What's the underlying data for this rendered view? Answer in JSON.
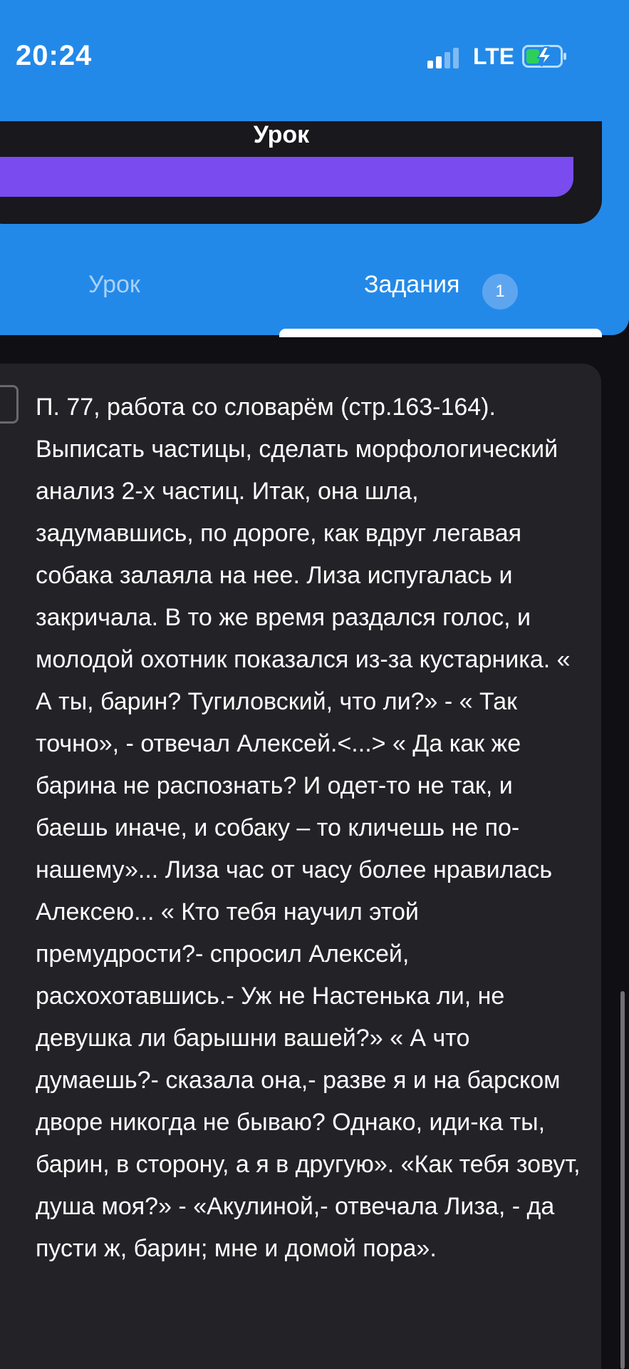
{
  "status_bar": {
    "time": "20:24",
    "network": "LTE",
    "signal_icon": "signal-bars-icon",
    "battery_icon": "battery-charging-icon",
    "battery_color": "#2dcf5b"
  },
  "header": {
    "title": "Урок",
    "background_color": "#2389e8",
    "progress_color": "#7a4cf0"
  },
  "tabs": [
    {
      "label": "Урок",
      "active": false
    },
    {
      "label": "Задания",
      "active": true,
      "badge": "1"
    }
  ],
  "task": {
    "checkbox_icon": "checkbox-icon",
    "text": "П. 77, работа со словарём (стр.163-164). Выписать частицы, сделать морфологический анализ 2-х частиц. Итак, она шла, задумавшись, по дороге, как вдруг легавая собака залаяла на нее. Лиза испугалась и закричала. В то же время раздался голос, и молодой охотник показался  из-за кустарника. « А ты, барин? Тугиловский,  что ли?» - « Так точно», - отвечал Алексей.<...> « Да как же барина не распознать? И одет-то не так, и баешь иначе, и собаку – то кличешь не по-нашему»... Лиза час от часу более нравилась Алексею... « Кто тебя научил этой премудрости?- спросил Алексей, расхохотавшись.- Уж не Настенька ли, не девушка ли барышни вашей?» « А что думаешь?- сказала она,- разве я и на барском дворе никогда не бываю? Однако, иди-ка ты, барин, в сторону, а я в другую». «Как тебя зовут, душа моя?» - «Акулиной,- отвечала Лиза, - да пусти ж, барин;  мне и домой пора»."
  }
}
